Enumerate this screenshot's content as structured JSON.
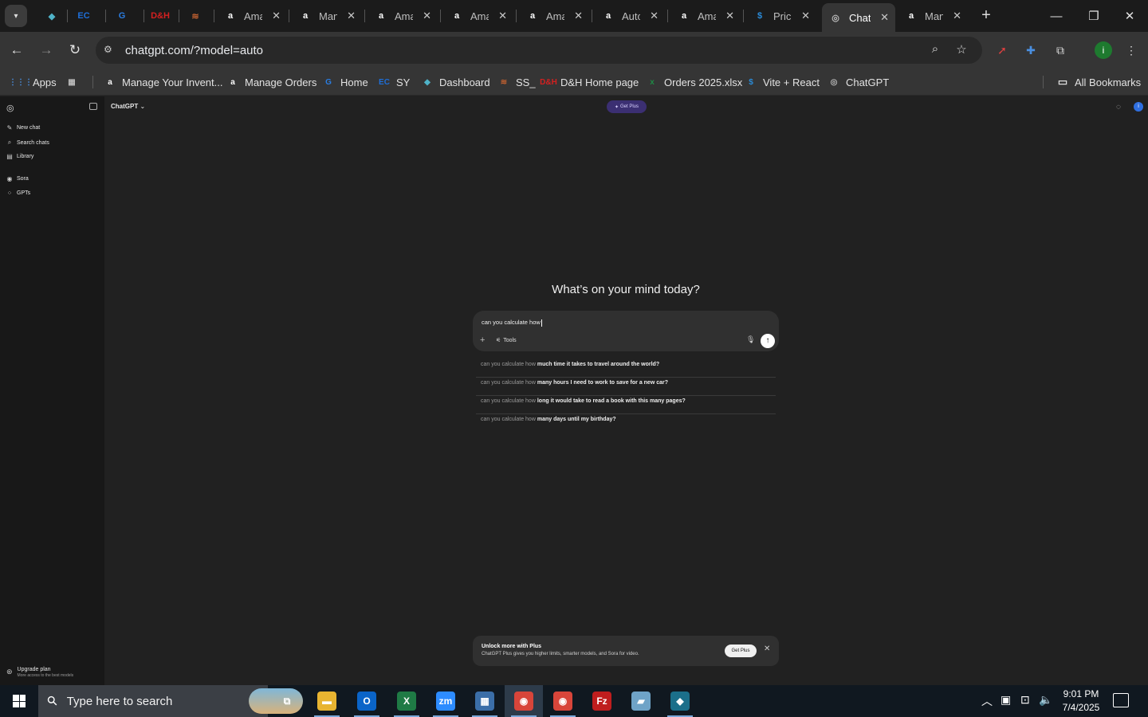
{
  "browser": {
    "tabs": [
      {
        "label": "",
        "fav_text": "◆",
        "fav_color": "#4fb3c8"
      },
      {
        "label": "",
        "fav_text": "EC",
        "fav_color": "#1e6fd9"
      },
      {
        "label": "",
        "fav_text": "G",
        "fav_color": "#2a7de1"
      },
      {
        "label": "",
        "fav_text": "D&H",
        "fav_color": "#d42020"
      },
      {
        "label": "",
        "fav_text": "≋",
        "fav_color": "#c06030"
      },
      {
        "label": "Ama",
        "fav_text": "a",
        "fav_color": "#ffffff"
      },
      {
        "label": "Man",
        "fav_text": "a",
        "fav_color": "#ffffff"
      },
      {
        "label": "Ama",
        "fav_text": "a",
        "fav_color": "#ffffff"
      },
      {
        "label": "Ama",
        "fav_text": "a",
        "fav_color": "#ffffff"
      },
      {
        "label": "Ama",
        "fav_text": "a",
        "fav_color": "#ffffff"
      },
      {
        "label": "Autc",
        "fav_text": "a",
        "fav_color": "#ffffff"
      },
      {
        "label": "Ama",
        "fav_text": "a",
        "fav_color": "#ffffff"
      },
      {
        "label": "Prici",
        "fav_text": "$",
        "fav_color": "#2a8bd8"
      },
      {
        "label": "Chat",
        "fav_text": "◎",
        "fav_color": "#bbbbbb"
      },
      {
        "label": "Man",
        "fav_text": "a",
        "fav_color": "#ffffff"
      }
    ],
    "active_tab_index": 13,
    "url": "chatgpt.com/?model=auto",
    "bookmarks": [
      {
        "label": "Apps",
        "icon": "⋮⋮⋮",
        "color": "#4a90e2"
      },
      {
        "label": "",
        "icon": "▦",
        "color": "#bbbbbb"
      },
      {
        "label": "Manage Your Invent...",
        "icon": "a",
        "color": "#ffffff"
      },
      {
        "label": "Manage Orders",
        "icon": "a",
        "color": "#ffffff"
      },
      {
        "label": "Home",
        "icon": "G",
        "color": "#2a7de1"
      },
      {
        "label": "SY",
        "icon": "EC",
        "color": "#1e6fd9"
      },
      {
        "label": "Dashboard",
        "icon": "◆",
        "color": "#4fb3c8"
      },
      {
        "label": "SS_",
        "icon": "≋",
        "color": "#c06030"
      },
      {
        "label": "D&H Home page",
        "icon": "D&H",
        "color": "#d42020"
      },
      {
        "label": "Orders 2025.xlsx",
        "icon": "x",
        "color": "#1f8a45"
      },
      {
        "label": "Vite + React",
        "icon": "$",
        "color": "#2a8bd8"
      },
      {
        "label": "ChatGPT",
        "icon": "◎",
        "color": "#bbbbbb"
      }
    ],
    "all_bookmarks_label": "All Bookmarks"
  },
  "chatgpt": {
    "model_label": "ChatGPT",
    "get_plus_pill": "Get Plus",
    "sidebar": {
      "items": [
        {
          "label": "New chat",
          "icon": "✎"
        },
        {
          "label": "Search chats",
          "icon": "⌕"
        },
        {
          "label": "Library",
          "icon": "▤"
        },
        {
          "label": "Sora",
          "icon": "◉"
        },
        {
          "label": "GPTs",
          "icon": "⁘"
        }
      ],
      "upgrade_title": "Upgrade plan",
      "upgrade_subtitle": "More access to the best models"
    },
    "heading": "What’s on your mind today?",
    "composer_text": "can you calculate how",
    "tools_label": "Tools",
    "suggestion_prefix": "can you calculate how",
    "suggestions": [
      "much time it takes to travel around the world?",
      "many hours I need to work to save for a new car?",
      "long it would take to read a book with this many pages?",
      "many days until my birthday?"
    ],
    "promo": {
      "title": "Unlock more with Plus",
      "body": "ChatGPT Plus gives you higher limits, smarter models, and Sora for video.",
      "button": "Get Plus"
    }
  },
  "taskbar": {
    "search_placeholder": "Type here to search",
    "apps": [
      {
        "name": "task-view",
        "glyph": "⧉",
        "color": "transparent"
      },
      {
        "name": "file-explorer",
        "glyph": "▬",
        "color": "#e8b431"
      },
      {
        "name": "outlook",
        "glyph": "O",
        "color": "#0a64c8"
      },
      {
        "name": "excel",
        "glyph": "X",
        "color": "#1f7a45"
      },
      {
        "name": "zoom",
        "glyph": "zm",
        "color": "#2d8cff"
      },
      {
        "name": "calculator",
        "glyph": "▦",
        "color": "#3b6ea8"
      },
      {
        "name": "chrome",
        "glyph": "◉",
        "color": "#d8453a"
      },
      {
        "name": "chrome-profile",
        "glyph": "◉",
        "color": "#d8453a"
      },
      {
        "name": "filezilla",
        "glyph": "Fz",
        "color": "#bf1e1e"
      },
      {
        "name": "notepad-app",
        "glyph": "▰",
        "color": "#6fa3c7"
      },
      {
        "name": "app-diamond",
        "glyph": "◆",
        "color": "#1b6f8a"
      }
    ],
    "time": "9:01 PM",
    "date": "7/4/2025"
  }
}
